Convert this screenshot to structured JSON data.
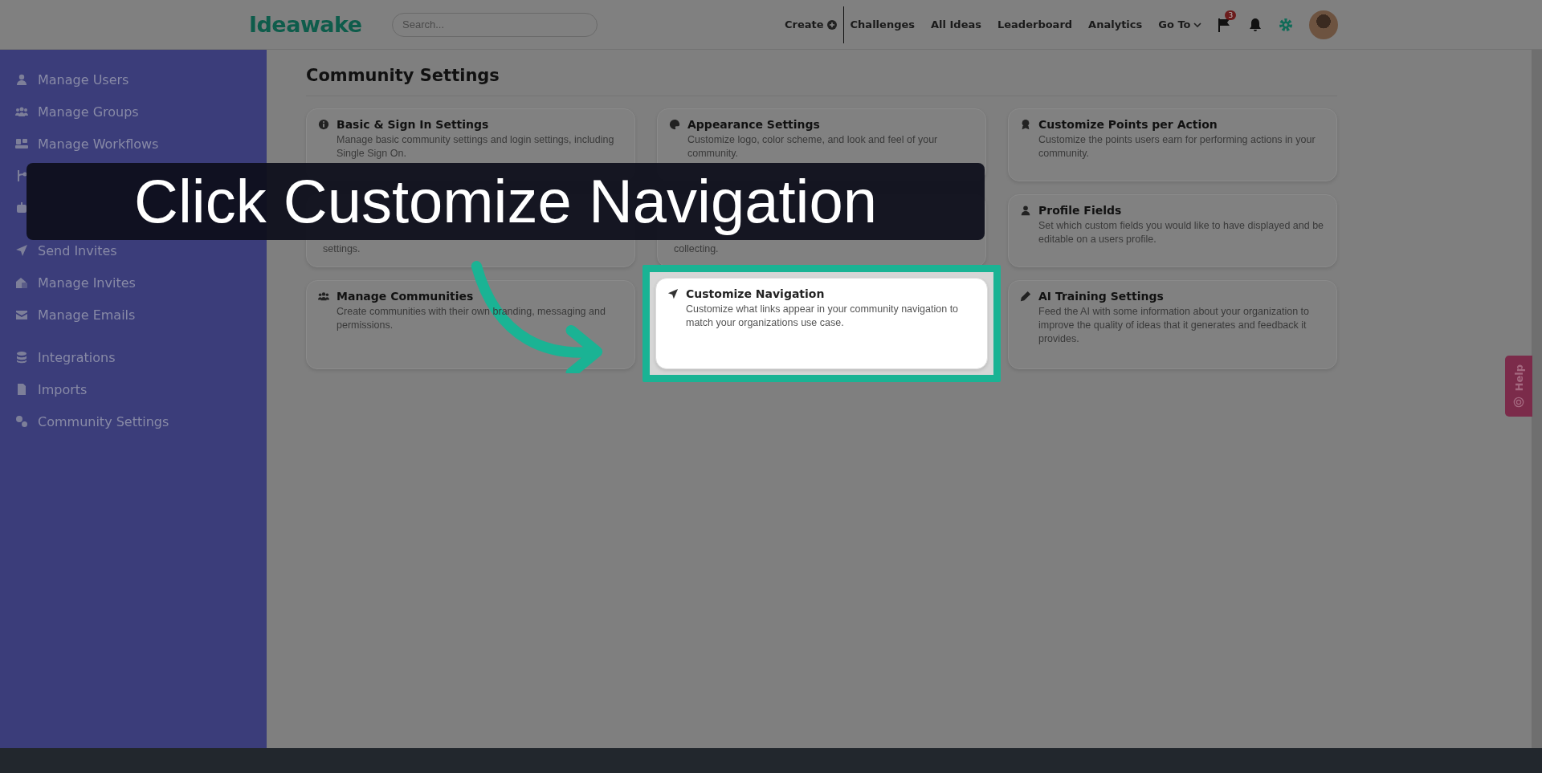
{
  "header": {
    "logo": "Ideawake",
    "search": {
      "placeholder": "Search..."
    },
    "nav": [
      {
        "kind": "create",
        "label": "Create"
      },
      {
        "kind": "link",
        "label": "Challenges"
      },
      {
        "kind": "link",
        "label": "All Ideas"
      },
      {
        "kind": "link",
        "label": "Leaderboard"
      },
      {
        "kind": "link",
        "label": "Analytics"
      },
      {
        "kind": "dropdown",
        "label": "Go To"
      }
    ],
    "flag_badge": "3"
  },
  "sidebar": {
    "groups": [
      [
        {
          "label": "Manage Users"
        },
        {
          "label": "Manage Groups"
        },
        {
          "label": "Manage Workflows"
        }
      ],
      [
        {
          "label": "Send Invites"
        },
        {
          "label": "Manage Invites"
        },
        {
          "label": "Manage Emails"
        }
      ],
      [
        {
          "label": "Integrations"
        },
        {
          "label": "Imports"
        },
        {
          "label": "Community Settings"
        }
      ]
    ]
  },
  "page_title": "Community Settings",
  "cards": [
    {
      "kind": "full",
      "title": "Basic & Sign In Settings",
      "description": "Manage basic community settings and login settings, including Single Sign On.",
      "highlighted": false
    },
    {
      "kind": "full",
      "title": "Appearance Settings",
      "description": "Customize logo, color scheme, and look and feel of your community.",
      "highlighted": false
    },
    {
      "kind": "full",
      "title": "Customize Points per Action",
      "description": "Customize the points users earn for performing actions in your community.",
      "highlighted": false
    },
    {
      "kind": "obscured",
      "description": "settings.",
      "highlighted": false
    },
    {
      "kind": "obscured",
      "description": "collecting.",
      "highlighted": false
    },
    {
      "kind": "full",
      "title": "Profile Fields",
      "description": "Set which custom fields you would like to have displayed and be editable on a users profile.",
      "highlighted": false
    },
    {
      "kind": "full",
      "title": "Manage Communities",
      "description": "Create communities with their own branding, messaging and permissions.",
      "highlighted": false
    },
    {
      "kind": "full",
      "title": "Customize Navigation",
      "description": "Customize what links appear in your community navigation to match your organizations use case.",
      "highlighted": true
    },
    {
      "kind": "full",
      "title": "AI Training Settings",
      "description": "Feed the AI with some information about your organization to improve the quality of ideas that it generates and feedback it provides.",
      "highlighted": false
    }
  ],
  "caption": "Click Customize Navigation",
  "help_tab": "Help"
}
